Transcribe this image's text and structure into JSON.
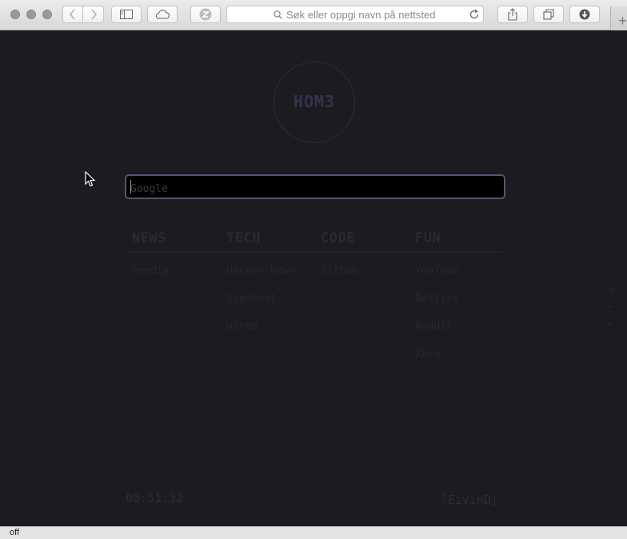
{
  "browser": {
    "address_placeholder": "Søk eller oppgi navn på nettsted",
    "new_tab_label": "+",
    "status_text": "off"
  },
  "page": {
    "logo": "HOM3",
    "search_placeholder": "Google",
    "categories": [
      {
        "title": "NEWS",
        "links": [
          "Feedly"
        ]
      },
      {
        "title": "TECH",
        "links": [
          "Hacker News",
          "Slashdot",
          "Wired"
        ]
      },
      {
        "title": "CODE",
        "links": [
          "Github"
        ]
      },
      {
        "title": "FUN",
        "links": [
          "YouTube",
          "Netflix",
          "Reddit",
          "Xkcd"
        ]
      }
    ],
    "clock": "00:51:32",
    "signature": "「EivinD」"
  },
  "colors": {
    "page_bg": "#1b1c20",
    "search_border": "#56546e",
    "logo_text": "#34334a"
  }
}
